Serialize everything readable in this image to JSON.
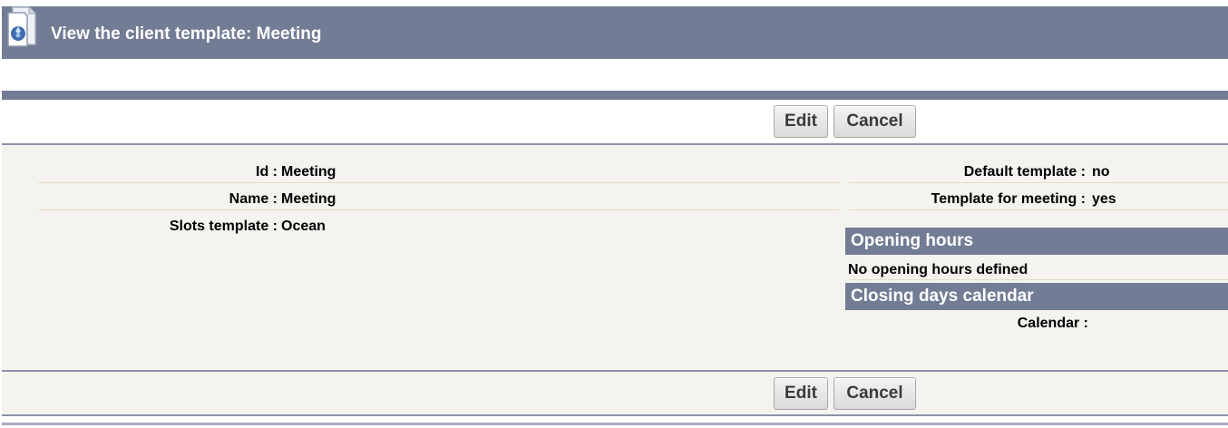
{
  "header": {
    "title": "View the client template: Meeting",
    "icon": "document-icon"
  },
  "toolbar": {
    "edit_label": "Edit",
    "cancel_label": "Cancel"
  },
  "details": {
    "id_label": "Id :",
    "id_value": "Meeting",
    "name_label": "Name :",
    "name_value": "Meeting",
    "slots_label": "Slots template :",
    "slots_value": "Ocean",
    "default_label": "Default template :",
    "default_value": "no",
    "meeting_label": "Template for meeting :",
    "meeting_value": "yes"
  },
  "opening_hours": {
    "heading": "Opening hours",
    "text": "No opening hours defined"
  },
  "closing_days": {
    "heading": "Closing days calendar",
    "calendar_label": "Calendar :",
    "calendar_value": ""
  },
  "colors": {
    "header_bg": "#727c94",
    "panel_bg": "#f5f3ef"
  }
}
